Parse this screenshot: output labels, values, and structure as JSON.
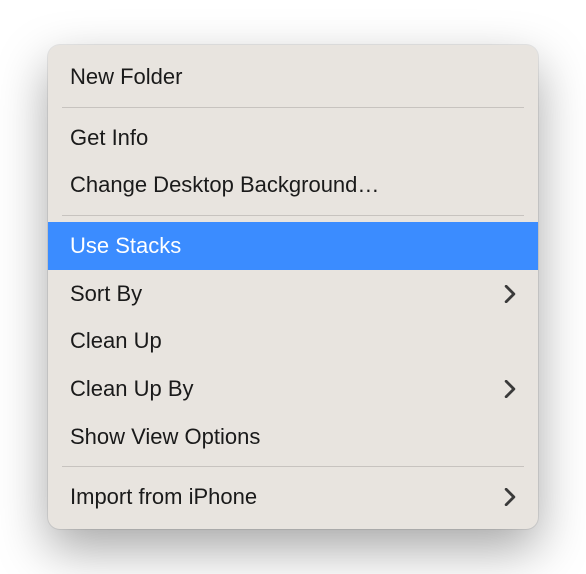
{
  "menu": {
    "groups": [
      {
        "items": [
          {
            "id": "new-folder",
            "label": "New Folder",
            "submenu": false,
            "highlighted": false
          }
        ]
      },
      {
        "items": [
          {
            "id": "get-info",
            "label": "Get Info",
            "submenu": false,
            "highlighted": false
          },
          {
            "id": "change-desktop-background",
            "label": "Change Desktop Background…",
            "submenu": false,
            "highlighted": false
          }
        ]
      },
      {
        "items": [
          {
            "id": "use-stacks",
            "label": "Use Stacks",
            "submenu": false,
            "highlighted": true
          },
          {
            "id": "sort-by",
            "label": "Sort By",
            "submenu": true,
            "highlighted": false
          },
          {
            "id": "clean-up",
            "label": "Clean Up",
            "submenu": false,
            "highlighted": false
          },
          {
            "id": "clean-up-by",
            "label": "Clean Up By",
            "submenu": true,
            "highlighted": false
          },
          {
            "id": "show-view-options",
            "label": "Show View Options",
            "submenu": false,
            "highlighted": false
          }
        ]
      },
      {
        "items": [
          {
            "id": "import-from-iphone",
            "label": "Import from iPhone",
            "submenu": true,
            "highlighted": false
          }
        ]
      }
    ]
  }
}
